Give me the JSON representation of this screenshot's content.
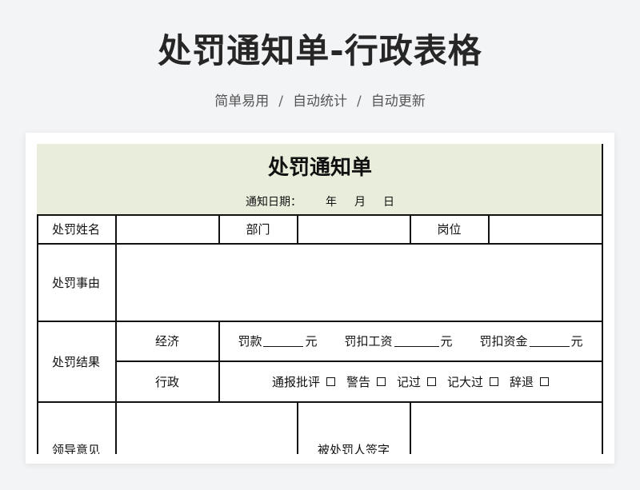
{
  "page": {
    "title": "处罚通知单-行政表格",
    "subtitle_items": [
      "简单易用",
      "自动统计",
      "自动更新"
    ],
    "subtitle_sep": "/"
  },
  "form": {
    "title": "处罚通知单",
    "date_label": "通知日期：",
    "year": "年",
    "month": "月",
    "day": "日",
    "row_name": {
      "label": "处罚姓名",
      "dept": "部门",
      "post": "岗位"
    },
    "row_reason": {
      "label": "处罚事由"
    },
    "row_result": {
      "label": "处罚结果",
      "economic": "经济",
      "fine": "罚款",
      "deduct_salary": "罚扣工资",
      "deduct_fund": "罚扣资金",
      "unit": "元",
      "admin": "行政",
      "options": [
        "通报批评",
        "警告",
        "记过",
        "记大过",
        "辞退"
      ],
      "checkbox": "☐"
    },
    "row_opinion": {
      "label": "领导意见",
      "signature": "被处罚人签字"
    }
  }
}
